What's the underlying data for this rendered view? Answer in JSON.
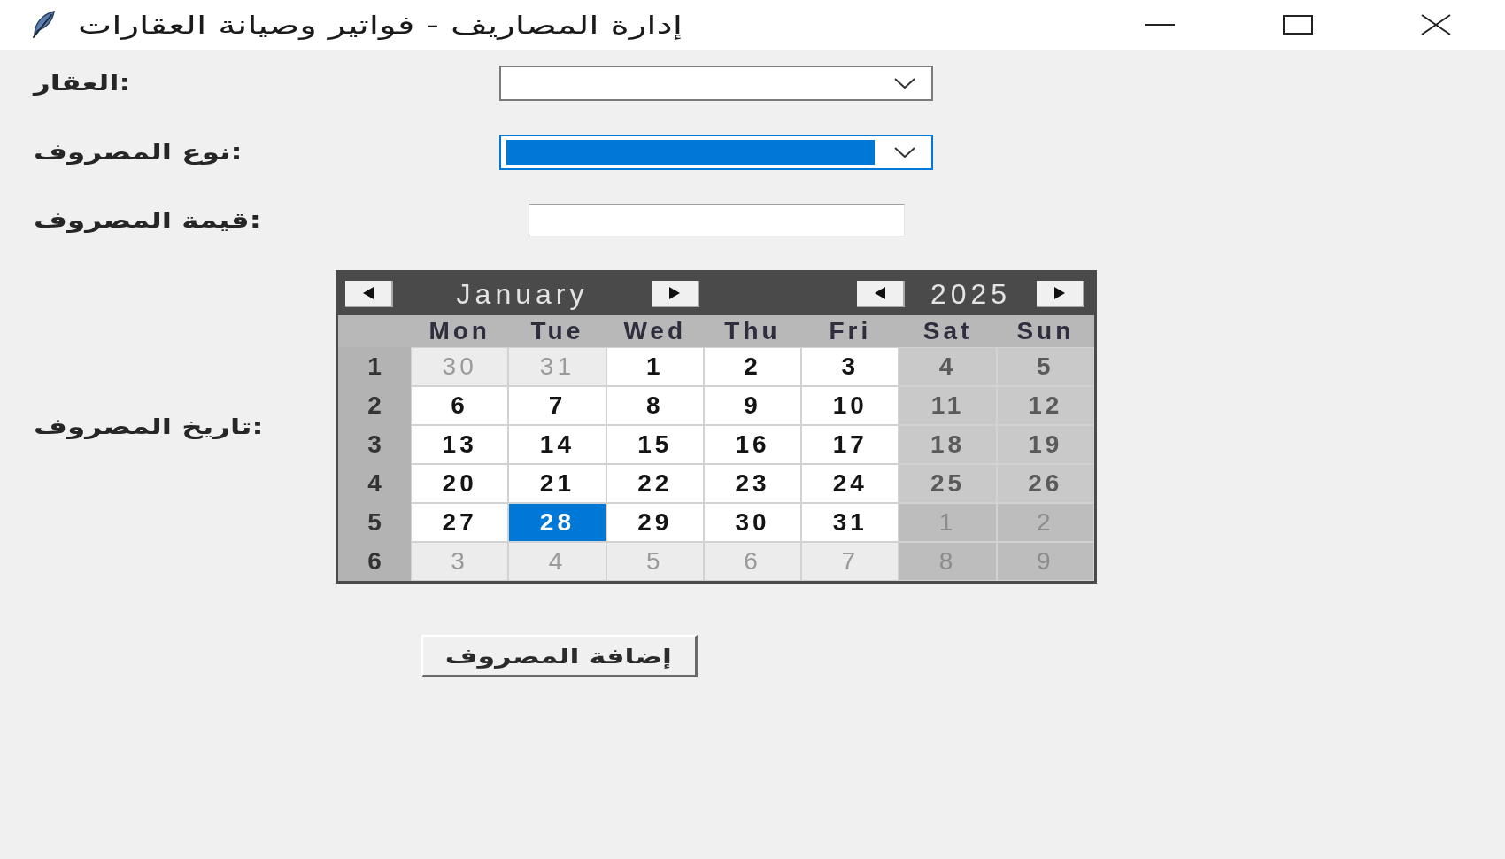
{
  "window": {
    "title": "إدارة المصاريف - فواتير وصيانة العقارات"
  },
  "form": {
    "fields": [
      {
        "kind": "combobox",
        "label": "العقار:",
        "focused": false
      },
      {
        "kind": "combobox",
        "label": "نوع المصروف:",
        "focused": true
      },
      {
        "kind": "entry",
        "label": "قيمة المصروف:",
        "focused": false
      }
    ]
  },
  "date_field": {
    "label": "تاريخ المصروف:"
  },
  "calendar": {
    "month": "January",
    "year": "2025",
    "weekdays": [
      "Sun",
      "Sat",
      "Fri",
      "Thu",
      "Wed",
      "Tue",
      "Mon"
    ],
    "weeks": [
      {
        "number": "1",
        "days": [
          {
            "day": "5",
            "other_month": false,
            "weekend": true,
            "selected": false
          },
          {
            "day": "4",
            "other_month": false,
            "weekend": true,
            "selected": false
          },
          {
            "day": "3",
            "other_month": false,
            "weekend": false,
            "selected": false
          },
          {
            "day": "2",
            "other_month": false,
            "weekend": false,
            "selected": false
          },
          {
            "day": "1",
            "other_month": false,
            "weekend": false,
            "selected": false
          },
          {
            "day": "31",
            "other_month": true,
            "weekend": false,
            "selected": false
          },
          {
            "day": "30",
            "other_month": true,
            "weekend": false,
            "selected": false
          }
        ]
      },
      {
        "number": "2",
        "days": [
          {
            "day": "12",
            "other_month": false,
            "weekend": true,
            "selected": false
          },
          {
            "day": "11",
            "other_month": false,
            "weekend": true,
            "selected": false
          },
          {
            "day": "10",
            "other_month": false,
            "weekend": false,
            "selected": false
          },
          {
            "day": "9",
            "other_month": false,
            "weekend": false,
            "selected": false
          },
          {
            "day": "8",
            "other_month": false,
            "weekend": false,
            "selected": false
          },
          {
            "day": "7",
            "other_month": false,
            "weekend": false,
            "selected": false
          },
          {
            "day": "6",
            "other_month": false,
            "weekend": false,
            "selected": false
          }
        ]
      },
      {
        "number": "3",
        "days": [
          {
            "day": "19",
            "other_month": false,
            "weekend": true,
            "selected": false
          },
          {
            "day": "18",
            "other_month": false,
            "weekend": true,
            "selected": false
          },
          {
            "day": "17",
            "other_month": false,
            "weekend": false,
            "selected": false
          },
          {
            "day": "16",
            "other_month": false,
            "weekend": false,
            "selected": false
          },
          {
            "day": "15",
            "other_month": false,
            "weekend": false,
            "selected": false
          },
          {
            "day": "14",
            "other_month": false,
            "weekend": false,
            "selected": false
          },
          {
            "day": "13",
            "other_month": false,
            "weekend": false,
            "selected": false
          }
        ]
      },
      {
        "number": "4",
        "days": [
          {
            "day": "26",
            "other_month": false,
            "weekend": true,
            "selected": false
          },
          {
            "day": "25",
            "other_month": false,
            "weekend": true,
            "selected": false
          },
          {
            "day": "24",
            "other_month": false,
            "weekend": false,
            "selected": false
          },
          {
            "day": "23",
            "other_month": false,
            "weekend": false,
            "selected": false
          },
          {
            "day": "22",
            "other_month": false,
            "weekend": false,
            "selected": false
          },
          {
            "day": "21",
            "other_month": false,
            "weekend": false,
            "selected": false
          },
          {
            "day": "20",
            "other_month": false,
            "weekend": false,
            "selected": false
          }
        ]
      },
      {
        "number": "5",
        "days": [
          {
            "day": "2",
            "other_month": true,
            "weekend": true,
            "selected": false
          },
          {
            "day": "1",
            "other_month": true,
            "weekend": true,
            "selected": false
          },
          {
            "day": "31",
            "other_month": false,
            "weekend": false,
            "selected": false
          },
          {
            "day": "30",
            "other_month": false,
            "weekend": false,
            "selected": false
          },
          {
            "day": "29",
            "other_month": false,
            "weekend": false,
            "selected": false
          },
          {
            "day": "28",
            "other_month": false,
            "weekend": false,
            "selected": true
          },
          {
            "day": "27",
            "other_month": false,
            "weekend": false,
            "selected": false
          }
        ]
      },
      {
        "number": "6",
        "days": [
          {
            "day": "9",
            "other_month": true,
            "weekend": true,
            "selected": false
          },
          {
            "day": "8",
            "other_month": true,
            "weekend": true,
            "selected": false
          },
          {
            "day": "7",
            "other_month": true,
            "weekend": false,
            "selected": false
          },
          {
            "day": "6",
            "other_month": true,
            "weekend": false,
            "selected": false
          },
          {
            "day": "5",
            "other_month": true,
            "weekend": false,
            "selected": false
          },
          {
            "day": "4",
            "other_month": true,
            "weekend": false,
            "selected": false
          },
          {
            "day": "3",
            "other_month": true,
            "weekend": false,
            "selected": false
          }
        ]
      }
    ]
  },
  "add_button": {
    "label": "إضافة المصروف"
  }
}
